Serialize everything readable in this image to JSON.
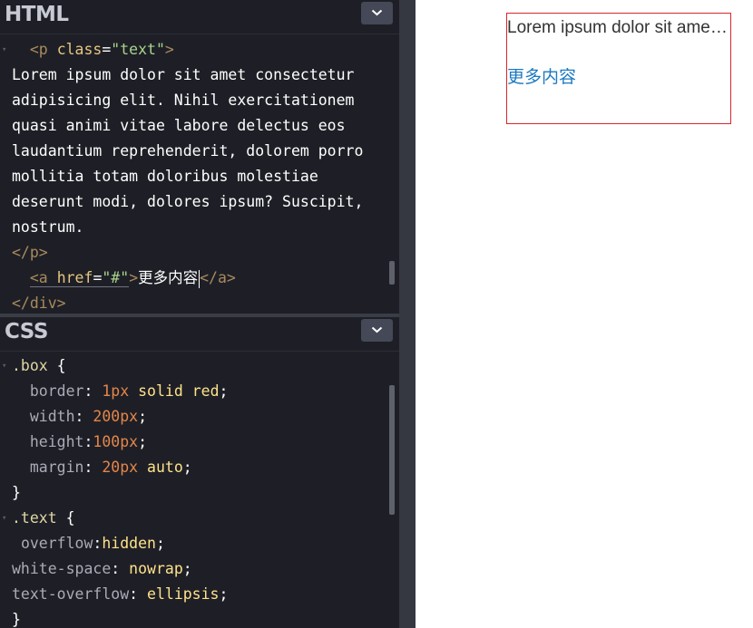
{
  "html_panel": {
    "title": "HTML",
    "lines": [
      [
        {
          "c": "t-punc",
          "t": "  "
        },
        {
          "c": "t-tag",
          "t": "<p "
        },
        {
          "c": "t-attr",
          "t": "class"
        },
        {
          "c": "t-punc",
          "t": "="
        },
        {
          "c": "t-str",
          "t": "\"text\""
        },
        {
          "c": "t-tag",
          "t": ">"
        }
      ],
      [
        {
          "c": "t-punc",
          "t": "Lorem ipsum dolor sit amet consectetur"
        }
      ],
      [
        {
          "c": "t-punc",
          "t": "adipisicing elit. Nihil exercitationem"
        }
      ],
      [
        {
          "c": "t-punc",
          "t": "quasi animi vitae labore delectus eos"
        }
      ],
      [
        {
          "c": "t-punc",
          "t": "laudantium reprehenderit, dolorem porro"
        }
      ],
      [
        {
          "c": "t-punc",
          "t": "mollitia totam doloribus molestiae"
        }
      ],
      [
        {
          "c": "t-punc",
          "t": "deserunt modi, dolores ipsum? Suscipit,"
        }
      ],
      [
        {
          "c": "t-punc",
          "t": "nostrum."
        }
      ],
      [
        {
          "c": "t-tag",
          "t": "</p>"
        }
      ],
      [
        {
          "c": "t-punc",
          "t": "  "
        },
        {
          "c": "t-tag anchor-underline",
          "t": "<a "
        },
        {
          "c": "t-attr anchor-underline",
          "t": "href"
        },
        {
          "c": "t-punc anchor-underline",
          "t": "="
        },
        {
          "c": "t-str anchor-underline",
          "t": "\"#\""
        },
        {
          "c": "t-tag",
          "t": ">"
        },
        {
          "c": "t-punc",
          "t": "更多内容"
        },
        {
          "c": "cursor",
          "t": ""
        },
        {
          "c": "t-tag",
          "t": "</a>"
        }
      ],
      [
        {
          "c": "t-tag",
          "t": "</div>"
        }
      ]
    ]
  },
  "css_panel": {
    "title": "CSS",
    "lines": [
      [
        {
          "c": "t-sel",
          "t": ".box"
        },
        {
          "c": "t-punc",
          "t": " {"
        }
      ],
      [
        {
          "c": "t-punc",
          "t": "  "
        },
        {
          "c": "t-prop",
          "t": "border"
        },
        {
          "c": "t-punc",
          "t": ": "
        },
        {
          "c": "t-num",
          "t": "1px"
        },
        {
          "c": "t-kw",
          "t": " solid red"
        },
        {
          "c": "t-punc",
          "t": ";"
        }
      ],
      [
        {
          "c": "t-punc",
          "t": "  "
        },
        {
          "c": "t-prop",
          "t": "width"
        },
        {
          "c": "t-punc",
          "t": ": "
        },
        {
          "c": "t-num",
          "t": "200px"
        },
        {
          "c": "t-punc",
          "t": ";"
        }
      ],
      [
        {
          "c": "t-punc",
          "t": "  "
        },
        {
          "c": "t-prop",
          "t": "height"
        },
        {
          "c": "t-punc",
          "t": ":"
        },
        {
          "c": "t-num",
          "t": "100px"
        },
        {
          "c": "t-punc",
          "t": ";"
        }
      ],
      [
        {
          "c": "t-punc",
          "t": "  "
        },
        {
          "c": "t-prop",
          "t": "margin"
        },
        {
          "c": "t-punc",
          "t": ": "
        },
        {
          "c": "t-num",
          "t": "20px"
        },
        {
          "c": "t-kw",
          "t": " auto"
        },
        {
          "c": "t-punc",
          "t": ";"
        }
      ],
      [
        {
          "c": "t-punc",
          "t": "}"
        }
      ],
      [
        {
          "c": "t-sel",
          "t": ".text"
        },
        {
          "c": "t-punc",
          "t": " {"
        }
      ],
      [
        {
          "c": "t-punc",
          "t": " "
        },
        {
          "c": "t-prop",
          "t": "overflow"
        },
        {
          "c": "t-punc",
          "t": ":"
        },
        {
          "c": "t-kw",
          "t": "hidden"
        },
        {
          "c": "t-punc",
          "t": ";"
        }
      ],
      [
        {
          "c": "t-prop",
          "t": "white-space"
        },
        {
          "c": "t-punc",
          "t": ": "
        },
        {
          "c": "t-kw",
          "t": "nowrap"
        },
        {
          "c": "t-punc",
          "t": ";"
        }
      ],
      [
        {
          "c": "t-prop",
          "t": "text-overflow"
        },
        {
          "c": "t-punc",
          "t": ": "
        },
        {
          "c": "t-kw",
          "t": "ellipsis"
        },
        {
          "c": "t-punc",
          "t": ";"
        }
      ],
      [
        {
          "c": "t-punc",
          "t": "}"
        }
      ]
    ]
  },
  "preview": {
    "paragraph": "Lorem ipsum dolor sit amet consectetur adipisicing elit. Nihil exercitationem quasi animi vitae labore delectus eos laudantium reprehenderit, dolorem porro mollitia totam doloribus molestiae deserunt modi, dolores ipsum? Suscipit, nostrum.",
    "link_text": "更多内容"
  },
  "colors": {
    "editor_bg": "#1e1f26",
    "box_border": "#d9262d",
    "link": "#1a7ac0"
  },
  "icons": {
    "collapse": "chevron-down-icon"
  }
}
